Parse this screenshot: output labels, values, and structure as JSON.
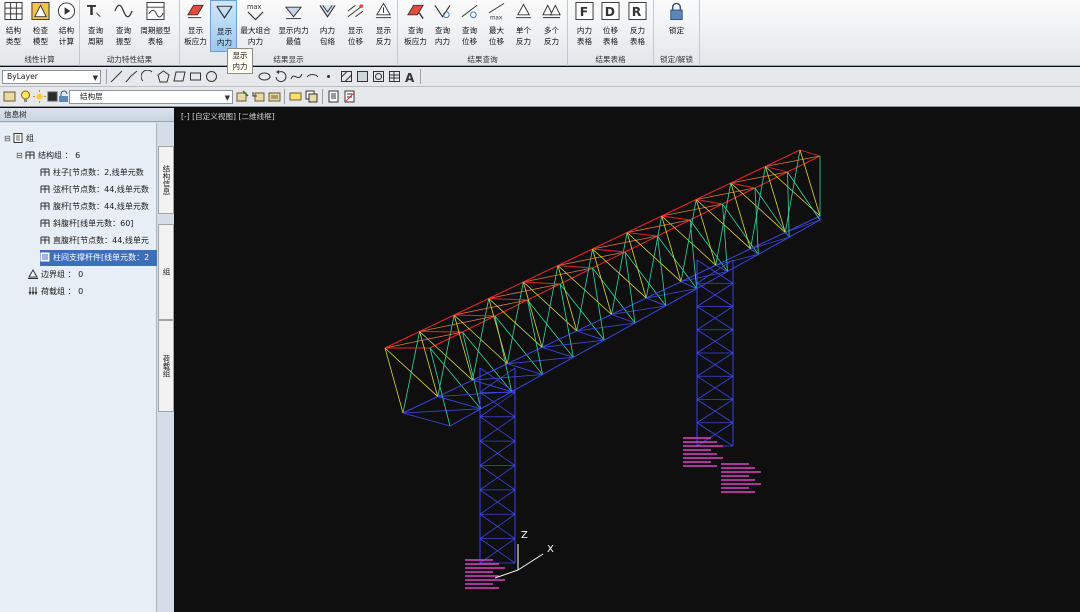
{
  "ribbon": {
    "groups": [
      {
        "title": "线性计算",
        "buttons": [
          "结构\n类型",
          "检查\n模型",
          "结构\n计算"
        ]
      },
      {
        "title": "动力特性结果",
        "buttons": [
          "查询\n周期",
          "查询\n振型",
          "周期振型\n表格"
        ]
      },
      {
        "title": "结果显示",
        "buttons": [
          "显示\n板应力",
          "显示\n内力",
          "最大组合\n内力",
          "显示内力\n最值",
          "内力\n包络",
          "显示\n位移",
          "显示\n反力"
        ]
      },
      {
        "title": "结果查询",
        "buttons": [
          "查询\n板应力",
          "查询\n内力",
          "查询\n位移",
          "最大\n位移",
          "单个\n反力",
          "多个\n反力"
        ]
      },
      {
        "title": "结果表格",
        "buttons": [
          "内力\n表格",
          "位移\n表格",
          "反力\n表格"
        ]
      },
      {
        "title": "锁定/解锁",
        "buttons": [
          "锁定"
        ]
      }
    ],
    "tooltip": "显示\n内力"
  },
  "toolbar": {
    "layer_combo": "ByLayer",
    "structure_layer": "结构层"
  },
  "side_panel": {
    "title": "信息树",
    "tree": {
      "root": "组",
      "structure_group": "结构组 ： 6",
      "members": [
        "柱子[节点数：2,线单元数",
        "弦杆[节点数：44,线单元数",
        "腹杆[节点数：44,线单元数",
        "斜腹杆[线单元数：60]",
        "直腹杆[节点数：44,线单元",
        "柱间支撑杆件[线单元数：2"
      ],
      "boundary_group": "边界组 ： 0",
      "load_group": "荷载组 ： 0"
    },
    "vertical_tabs": [
      "结构信息",
      "组",
      "荷载组"
    ]
  },
  "viewport": {
    "label": "[-] [自定义视图] [二维线框]",
    "axis_labels": {
      "x": "X",
      "z": "Z"
    },
    "colors": {
      "top_chord": "#e8222a",
      "bottom_chord": "#3b46e0",
      "mid": "#d8d83c",
      "diag": "#35d8a0",
      "support_text": "#e040c8"
    }
  }
}
